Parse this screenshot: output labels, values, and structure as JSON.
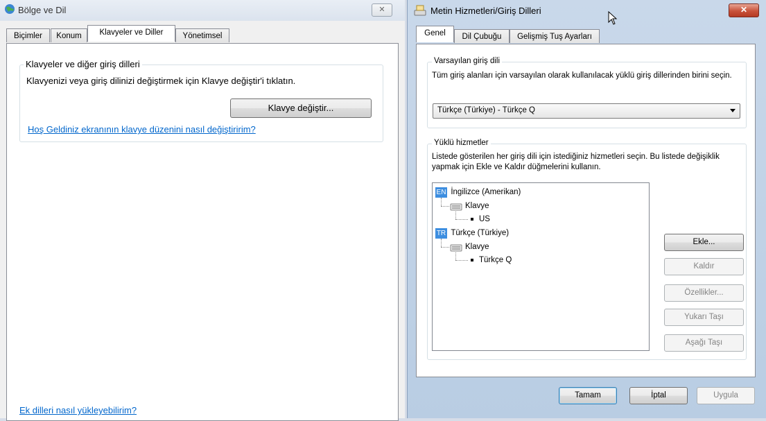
{
  "left_window": {
    "title": "Bölge ve Dil",
    "close_label": "✕",
    "tabs": [
      "Biçimler",
      "Konum",
      "Klavyeler ve Diller",
      "Yönetimsel"
    ],
    "group_title": "Klavyeler ve diğer giriş dilleri",
    "group_desc": "Klavyenizi veya giriş dilinizi değiştirmek için Klavye değiştir'i tıklatın.",
    "change_keyboard_button": "Klavye değiştir...",
    "welcome_link": "Hoş Geldiniz ekranının klavye düzenini nasıl değiştiririm?",
    "install_link": "Ek dilleri nasıl yükleyebilirim?"
  },
  "right_window": {
    "title": "Metin Hizmetleri/Giriş Dilleri",
    "close_label": "✕",
    "tabs": [
      "Genel",
      "Dil Çubuğu",
      "Gelişmiş Tuş Ayarları"
    ],
    "default_group_title": "Varsayılan giriş dili",
    "default_desc": "Tüm giriş alanları için varsayılan olarak kullanılacak yüklü giriş dillerinden birini seçin.",
    "default_select_value": "Türkçe (Türkiye) - Türkçe Q",
    "installed_group_title": "Yüklü hizmetler",
    "installed_desc": "Listede gösterilen her giriş dili için istediğiniz hizmetleri seçin. Bu listede değişiklik yapmak için Ekle ve Kaldır düğmelerini kullanın.",
    "tree": {
      "lang1_badge": "EN",
      "lang1_name": "İngilizce (Amerikan)",
      "lang1_group": "Klavye",
      "lang1_layout": "US",
      "lang2_badge": "TR",
      "lang2_name": "Türkçe (Türkiye)",
      "lang2_group": "Klavye",
      "lang2_layout": "Türkçe Q"
    },
    "buttons": {
      "add": "Ekle...",
      "remove": "Kaldır",
      "properties": "Özellikler...",
      "move_up": "Yukarı Taşı",
      "move_down": "Aşağı Taşı",
      "ok": "Tamam",
      "cancel": "İptal",
      "apply": "Uygula"
    },
    "icons": {
      "globe": "globe-icon",
      "keyboard": "keyboard-icon",
      "text-services": "text-services-icon",
      "cursor": "mouse-cursor-icon"
    }
  }
}
